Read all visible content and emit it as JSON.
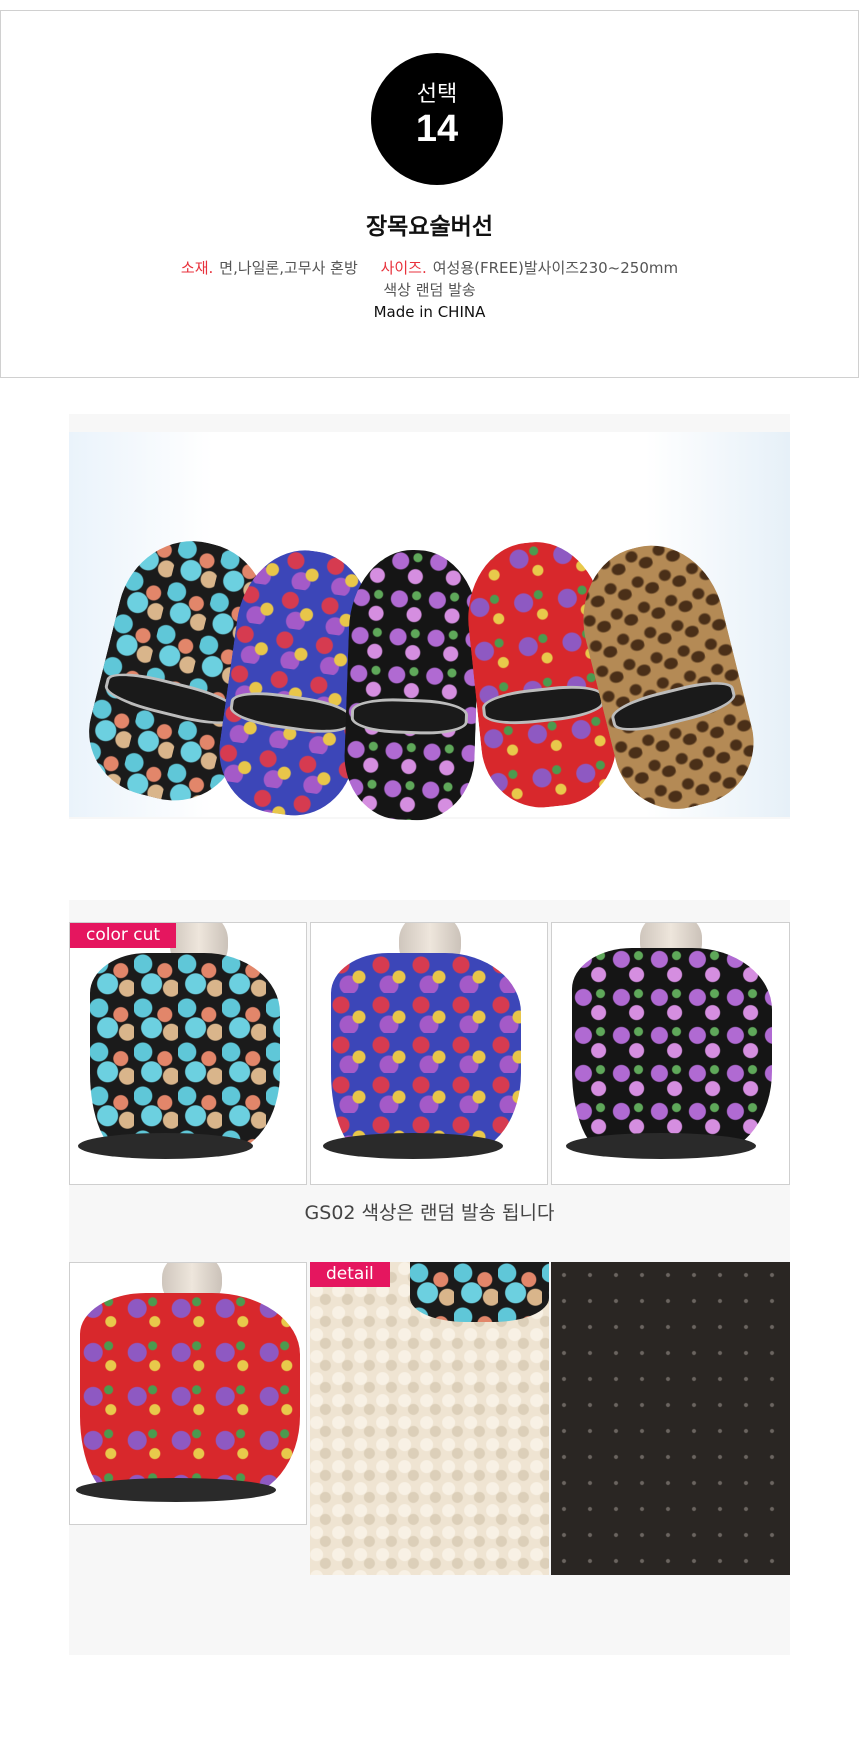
{
  "badge": {
    "label": "선택",
    "number": "14"
  },
  "product": {
    "title": "장목요술버선",
    "material_key": "소재.",
    "material_value": "면,나일론,고무사 혼방",
    "size_key": "사이즈.",
    "size_value": "여성용(FREE)발사이즈230~250mm",
    "color_note": "색상 랜덤 발송",
    "origin": "Made in CHINA"
  },
  "gallery": {
    "color_tag": "color cut",
    "detail_tag": "detail",
    "notice": "GS02 색상은 랜덤 발송 됩니다"
  },
  "colors": {
    "accent_red": "#e8323c",
    "tag_pink": "#e5165f",
    "badge_black": "#000000"
  }
}
